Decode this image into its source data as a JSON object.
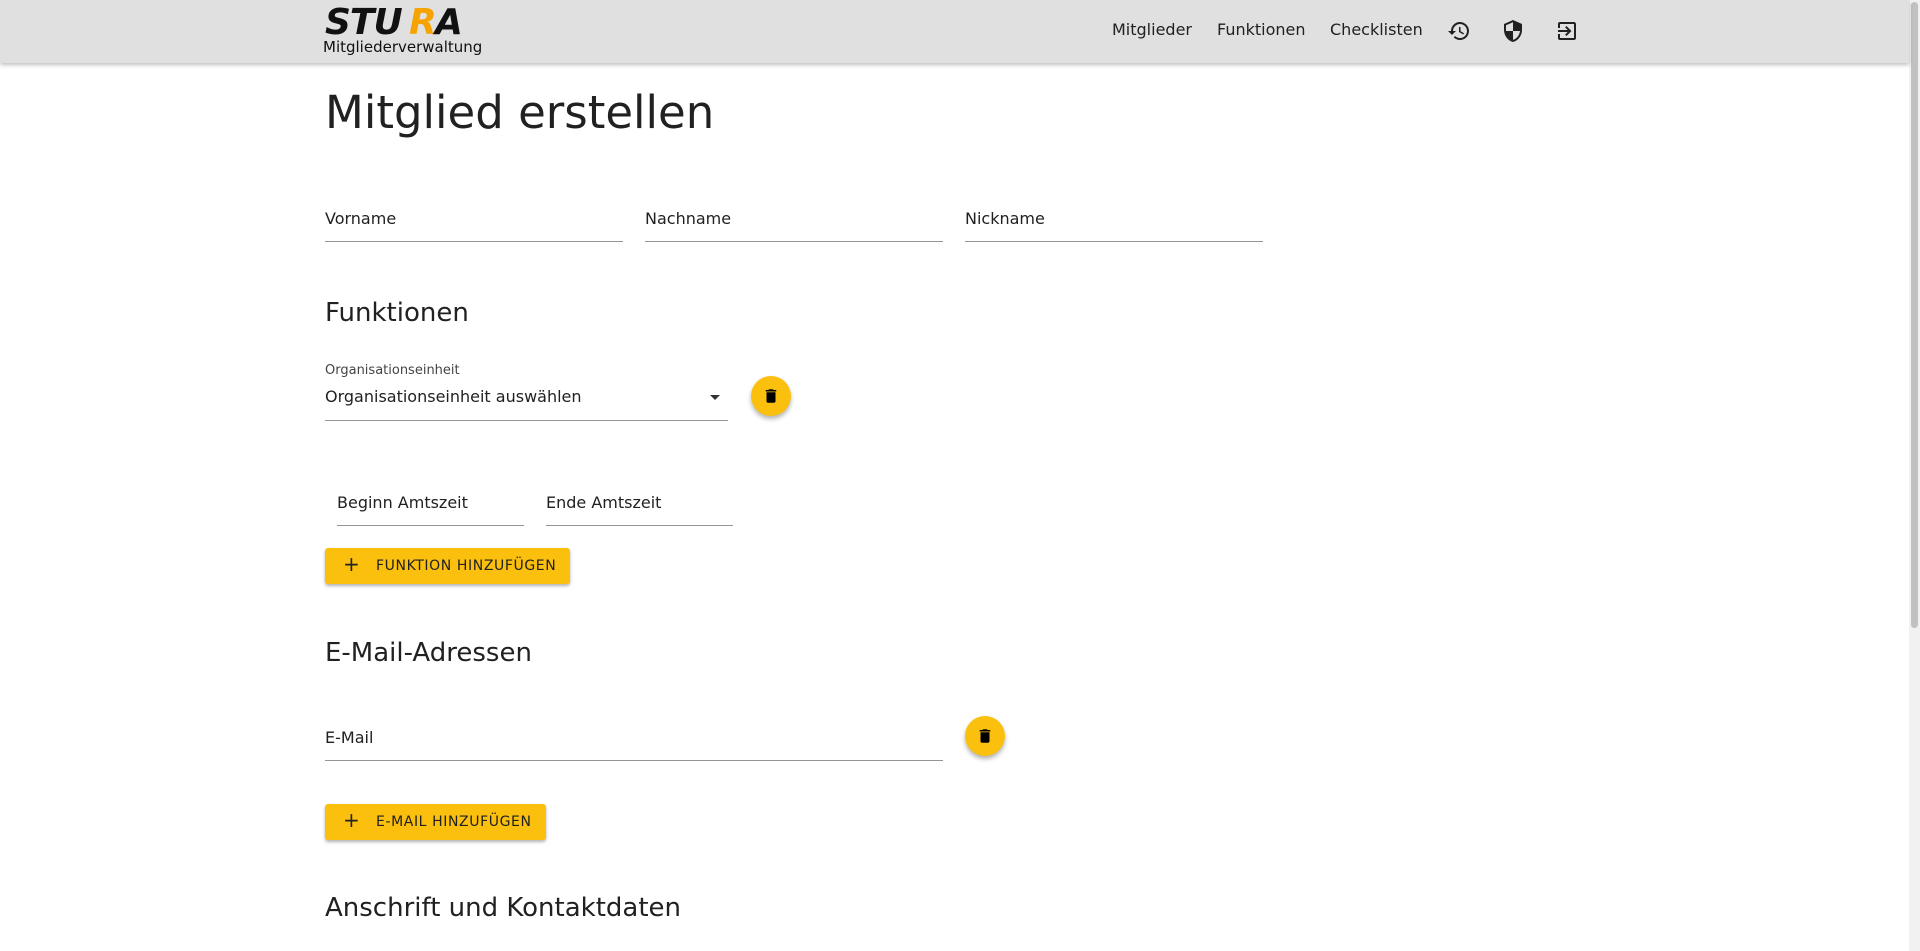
{
  "header": {
    "logo_text": "STURA",
    "subtitle": "Mitgliederverwaltung",
    "nav": [
      "Mitglieder",
      "Funktionen",
      "Checklisten"
    ],
    "icons": [
      "history-icon",
      "shield-icon",
      "logout-icon"
    ]
  },
  "page": {
    "title": "Mitglied erstellen"
  },
  "name_fields": {
    "first_name": "Vorname",
    "last_name": "Nachname",
    "nickname": "Nickname"
  },
  "functions": {
    "title": "Funktionen",
    "org_unit_label": "Organisationseinheit",
    "org_unit_value": "Organisationseinheit auswählen",
    "start_label": "Beginn Amtszeit",
    "end_label": "Ende Amtszeit",
    "add_button": "FUNKTION HINZUFÜGEN"
  },
  "emails": {
    "title": "E-Mail-Adressen",
    "email_label": "E-Mail",
    "add_button": "E-MAIL HINZUFÜGEN"
  },
  "address": {
    "title": "Anschrift und Kontaktdaten"
  },
  "colors": {
    "accent": "#fbbf0e",
    "appbar": "#e0e0e0",
    "text": "#212121"
  }
}
